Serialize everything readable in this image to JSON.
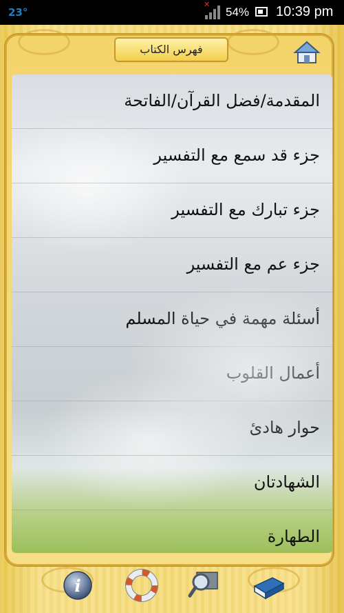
{
  "status_bar": {
    "temperature": "23°",
    "battery_percent": "54%",
    "clock": "10:39 pm",
    "icons": [
      "signal-icon",
      "battery-icon"
    ]
  },
  "header": {
    "title": "فهرس الكتاب",
    "home_icon": "home-icon"
  },
  "chapters": [
    "المقدمة/فضل القرآن/الفاتحة",
    "جزء قد سمع مع التفسير",
    "جزء تبارك مع التفسير",
    "جزء عم مع التفسير",
    "أسئلة مهمة في حياة المسلم",
    "أعمال القلوب",
    "حوار هادئ",
    "الشهادتان",
    "الطهارة"
  ],
  "toolbar": {
    "icons": [
      "info-icon",
      "help-lifebuoy-icon",
      "search-icon",
      "book-icon"
    ]
  },
  "colors": {
    "frame": "#f5db7a",
    "frame_border": "#c99a2c",
    "status_temp": "#1e7fc2"
  }
}
